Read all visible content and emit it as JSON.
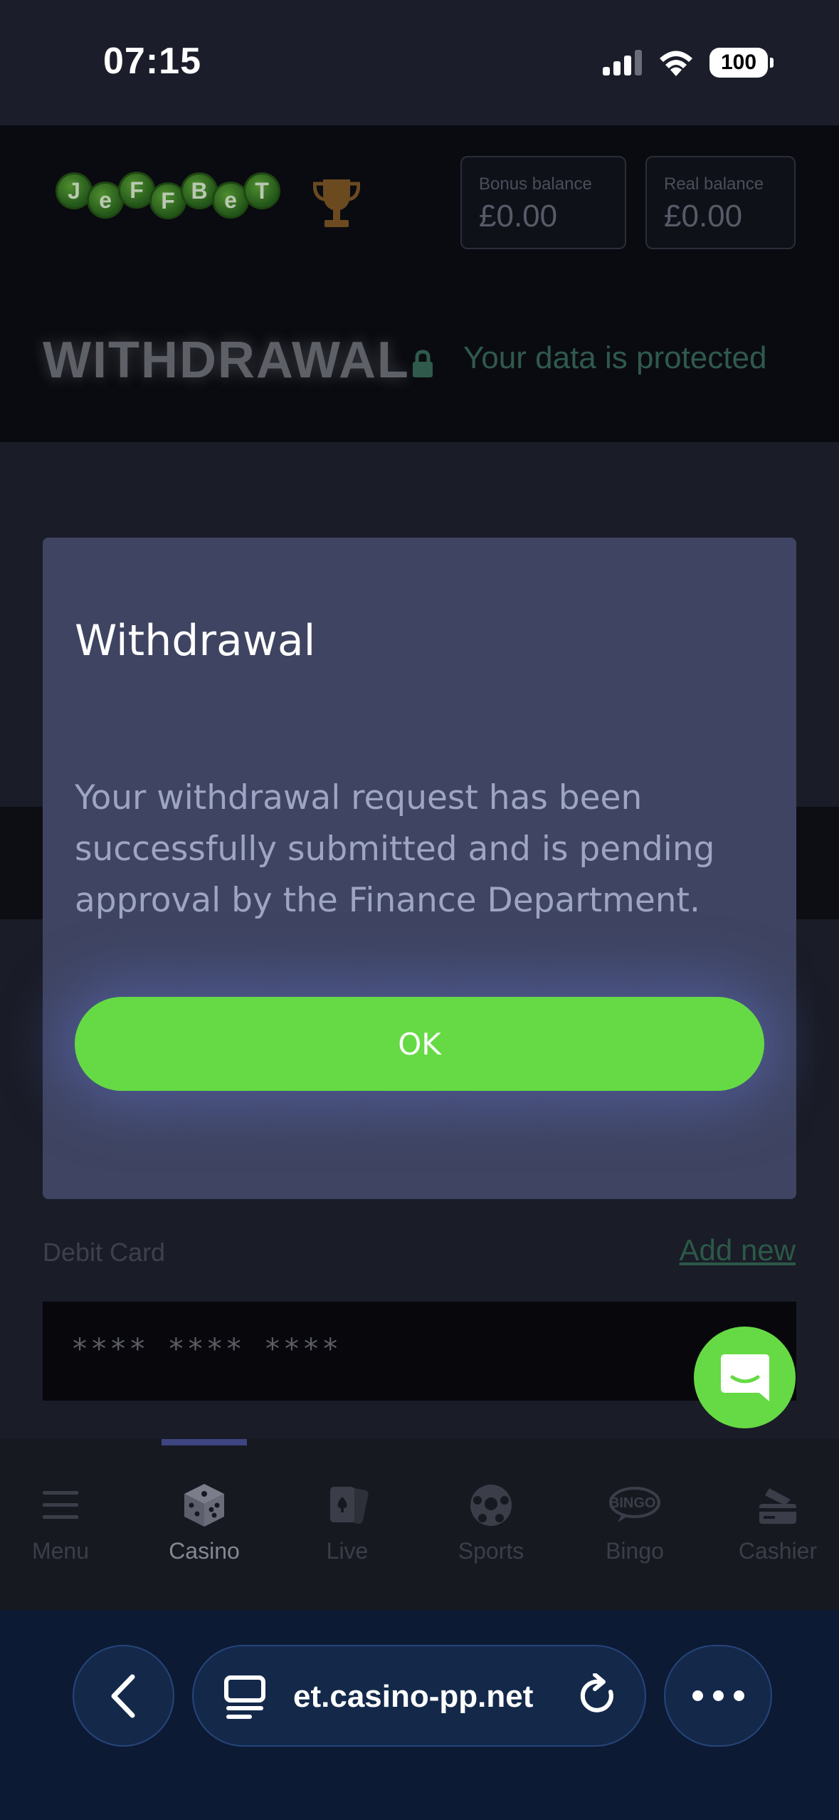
{
  "status_bar": {
    "time": "07:15",
    "battery": "100"
  },
  "header": {
    "logo_letters": [
      "J",
      "e",
      "F",
      "F",
      "B",
      "e",
      "T"
    ],
    "bonus_balance_label": "Bonus balance",
    "bonus_balance_value": "£0.00",
    "real_balance_label": "Real balance",
    "real_balance_value": "£0.00"
  },
  "page": {
    "title": "WITHDRAWAL",
    "protected_text": "Your data is protected",
    "debit_card_label": "Debit Card",
    "add_new_label": "Add new",
    "card_placeholder": "**** **** ****"
  },
  "modal": {
    "title": "Withdrawal",
    "message": "Your withdrawal request has been successfully submitted and is pending approval by the Finance Department.",
    "ok_label": "OK"
  },
  "bottom_nav": {
    "items": [
      {
        "label": "Menu",
        "icon": "menu-icon"
      },
      {
        "label": "Casino",
        "icon": "dice-icon"
      },
      {
        "label": "Live",
        "icon": "cards-icon"
      },
      {
        "label": "Sports",
        "icon": "soccer-ball-icon"
      },
      {
        "label": "Bingo",
        "icon": "bingo-icon"
      },
      {
        "label": "Cashier",
        "icon": "cashier-icon"
      }
    ],
    "active": "Casino"
  },
  "browser": {
    "url": "et.casino-pp.net"
  },
  "colors": {
    "accent_green": "#66da45",
    "modal_bg": "#3e4461",
    "browser_bg": "#0c1a33"
  }
}
